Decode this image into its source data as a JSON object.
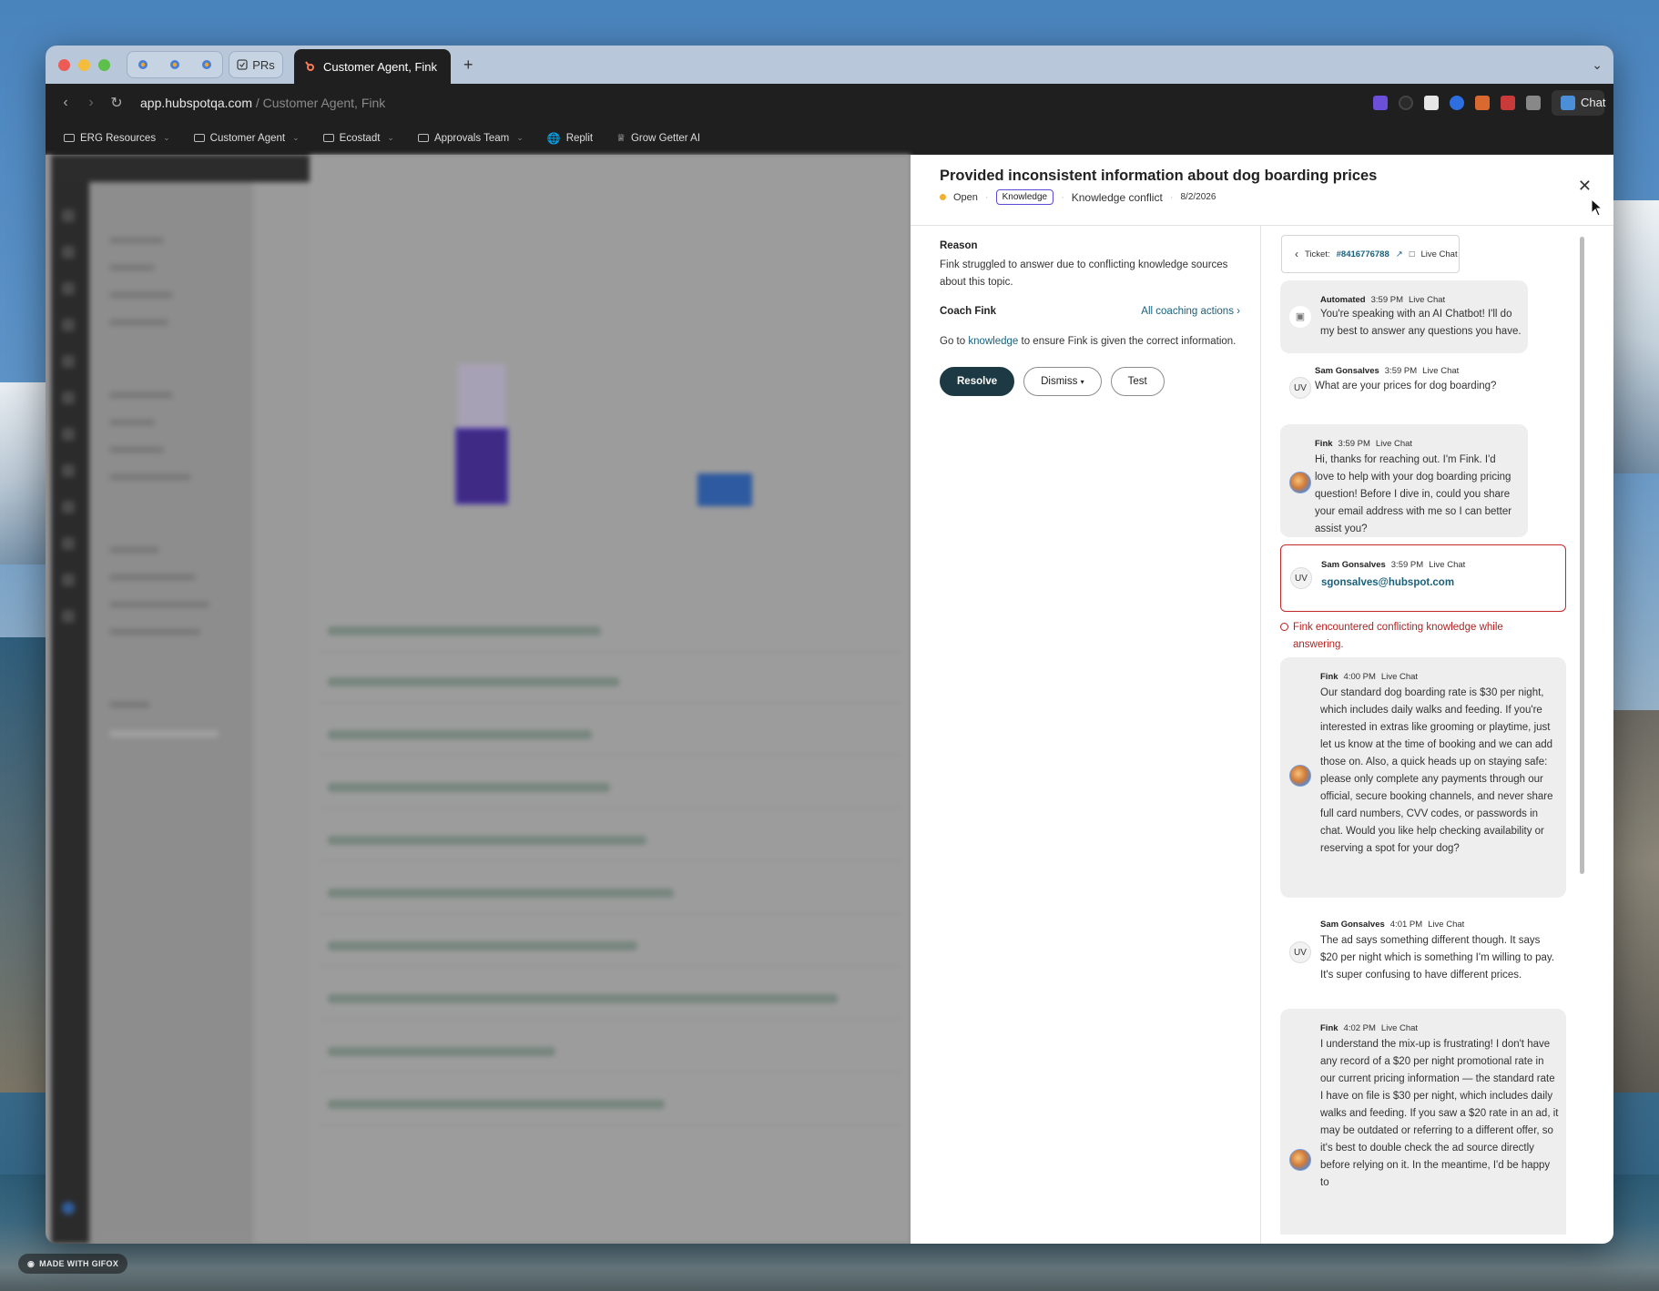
{
  "browser": {
    "tabs": {
      "pinned_label": "PRs",
      "active_label": "Customer Agent, Fink",
      "new_tab": "+"
    },
    "address": {
      "domain": "app.hubspotqa.com",
      "path": " / Customer Agent, Fink"
    },
    "chat_button": "Chat",
    "bookmarks": [
      {
        "label": "ERG Resources",
        "icon": "folder-icon",
        "dropdown": true
      },
      {
        "label": "Customer Agent",
        "icon": "folder-icon",
        "dropdown": true
      },
      {
        "label": "Ecostadt",
        "icon": "folder-icon",
        "dropdown": true
      },
      {
        "label": "Approvals Team",
        "icon": "folder-icon",
        "dropdown": true
      },
      {
        "label": "Replit",
        "icon": "globe-icon",
        "dropdown": false
      },
      {
        "label": "Grow Getter AI",
        "icon": "crown-icon",
        "dropdown": false
      }
    ]
  },
  "panel": {
    "title": "Provided inconsistent information about dog boarding prices",
    "status": "Open",
    "status_color": "#f0b032",
    "tag": "Knowledge",
    "category": "Knowledge conflict",
    "date": "8/2/2026",
    "reason_label": "Reason",
    "reason_text": "Fink struggled to answer due to conflicting knowledge sources about this topic.",
    "coach_label": "Coach Fink",
    "coach_link": "All coaching actions",
    "coach_text_pre": "Go to ",
    "coach_text_link": "knowledge",
    "coach_text_post": " to ensure Fink is given the correct information.",
    "buttons": {
      "resolve": "Resolve",
      "dismiss": "Dismiss",
      "test": "Test"
    }
  },
  "conversation": {
    "ticket_prefix": "Ticket:",
    "ticket_number": "#8416776788",
    "channel_badge": "Live Chat",
    "messages": [
      {
        "sender": "Automated",
        "time": "3:59 PM",
        "channel": "Live Chat",
        "avatar": "bot-icon",
        "text": "You're speaking with an AI Chatbot! I'll do my best to answer any questions you have."
      },
      {
        "sender": "Sam Gonsalves",
        "time": "3:59 PM",
        "channel": "Live Chat",
        "avatar": "UV",
        "text": "What are your prices for dog boarding?"
      },
      {
        "sender": "Fink",
        "time": "3:59 PM",
        "channel": "Live Chat",
        "avatar": "fink-avatar",
        "text": "Hi, thanks for reaching out. I'm Fink. I'd love to help with your dog boarding pricing question! Before I dive in, could you share your email address with me so I can better assist you?"
      },
      {
        "sender": "Sam Gonsalves",
        "time": "3:59 PM",
        "channel": "Live Chat",
        "avatar": "UV",
        "text": "sgonsalves@hubspot.com"
      },
      {
        "sender": "Fink",
        "time": "4:00 PM",
        "channel": "Live Chat",
        "avatar": "fink-avatar",
        "text": "Our standard dog boarding rate is $30 per night, which includes daily walks and feeding. If you're interested in extras like grooming or playtime, just let us know at the time of booking and we can add those on. Also, a quick heads up on staying safe: please only complete any payments through our official, secure booking channels, and never share full card numbers, CVV codes, or passwords in chat. Would you like help checking availability or reserving a spot for your dog?"
      },
      {
        "sender": "Sam Gonsalves",
        "time": "4:01 PM",
        "channel": "Live Chat",
        "avatar": "UV",
        "text": "The ad says something different though. It says $20 per night which is something I'm willing to pay. It's super confusing to have different prices."
      },
      {
        "sender": "Fink",
        "time": "4:02 PM",
        "channel": "Live Chat",
        "avatar": "fink-avatar",
        "text": "I understand the mix-up is frustrating! I don't have any record of a $20 per night promotional rate in our current pricing information — the standard rate I have on file is $30 per night, which includes daily walks and feeding. If you saw a $20 rate in an ad, it may be outdated or referring to a different offer, so it's best to double check the ad source directly before relying on it. In the meantime, I'd be happy to"
      }
    ],
    "warning": "Fink encountered conflicting knowledge while answering."
  },
  "footer": {
    "gifox_badge": "MADE WITH GIFOX"
  }
}
